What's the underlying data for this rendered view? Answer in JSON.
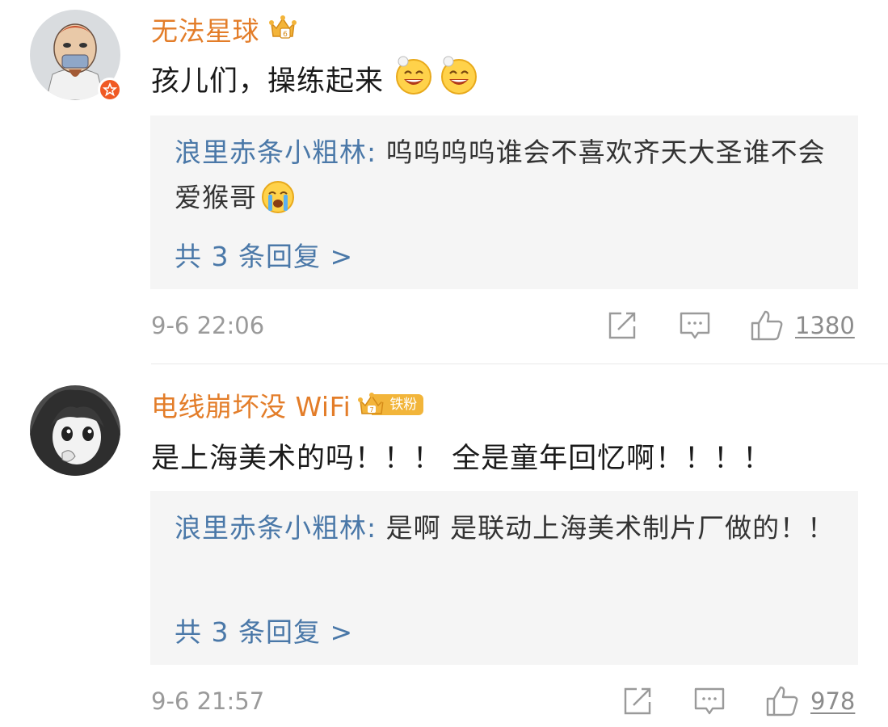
{
  "comments": [
    {
      "username": "无法星球",
      "content_text": "孩儿们，操练起来",
      "reply_user": "浪里赤条小粗林:",
      "reply_text": " 呜呜呜呜谁会不喜欢齐天大圣谁不会爱猴哥",
      "more_replies": "共 3 条回复 >",
      "time": "9-6 22:06",
      "likes": "1380"
    },
    {
      "username": "电线崩坏没 WiFi",
      "fan_badge": "铁粉",
      "content_text": "是上海美术的吗！！！ 全是童年回忆啊！！！！",
      "reply_user": "浪里赤条小粗林:",
      "reply_text": " 是啊 是联动上海美术制片厂做的！！",
      "more_replies": "共 3 条回复 >",
      "time": "9-6 21:57",
      "likes": "978"
    }
  ],
  "colors": {
    "username": "#e37d29",
    "link": "#4a78a8",
    "meta": "#9a9a9a",
    "reply_bg": "#f5f5f5",
    "badge": "#f2b53a",
    "verified": "#f05a24"
  },
  "icons": [
    "verified-badge-icon",
    "crown-icon",
    "grin-emoji-icon",
    "crying-emoji-icon",
    "repost-icon",
    "comment-icon",
    "like-icon"
  ]
}
